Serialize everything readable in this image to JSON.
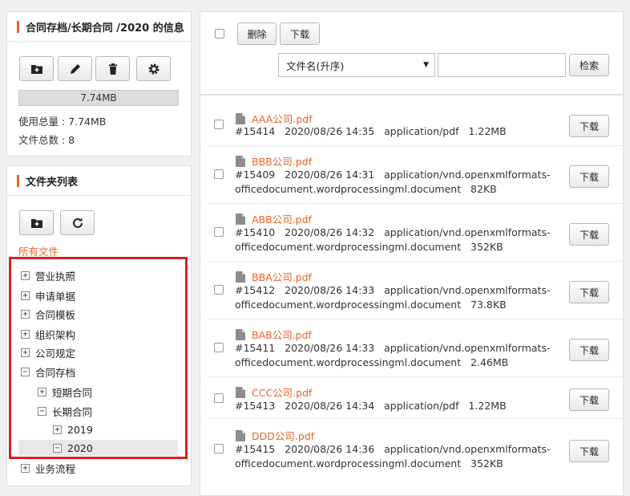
{
  "info_panel": {
    "title": "合同存档/长期合同 /2020 的信息",
    "toolbar_icons": [
      "folder-add-icon",
      "pencil-icon",
      "trash-icon",
      "gear-icon"
    ],
    "usage_bar_text": "7.74MB",
    "total_usage": "使用总量 : 7.74MB",
    "file_count": "文件总数 : 8"
  },
  "folder_panel": {
    "title": "文件夹列表",
    "toolbar_icons": [
      "folder-add-icon",
      "refresh-icon"
    ],
    "all_files_label": "所有文件",
    "tree": [
      {
        "label": "营业执照",
        "toggle": "+",
        "level": 0
      },
      {
        "label": "申请单据",
        "toggle": "+",
        "level": 0
      },
      {
        "label": "合同模板",
        "toggle": "+",
        "level": 0
      },
      {
        "label": "组织架构",
        "toggle": "+",
        "level": 0
      },
      {
        "label": "公司规定",
        "toggle": "+",
        "level": 0
      },
      {
        "label": "合同存档",
        "toggle": "−",
        "level": 0
      },
      {
        "label": "短期合同",
        "toggle": "+",
        "level": 1
      },
      {
        "label": "长期合同",
        "toggle": "−",
        "level": 1
      },
      {
        "label": "2019",
        "toggle": "+",
        "level": 2
      },
      {
        "label": "2020",
        "toggle": "−",
        "level": 2,
        "selected": true
      },
      {
        "label": "业务流程",
        "toggle": "+",
        "level": 0
      }
    ]
  },
  "toolbar": {
    "delete_label": "删除",
    "download_label": "下载",
    "sort_select_value": "文件名(升序)",
    "search_label": "检索",
    "search_value": ""
  },
  "files": [
    {
      "name": "AAA公司.pdf",
      "meta_line1": "#15414   2020/08/26 14:35   application/pdf   1.22MB",
      "meta_line2": "",
      "button": "下载"
    },
    {
      "name": "BBB公司.pdf",
      "meta_line1": "#15409   2020/08/26 14:31   application/vnd.openxmlformats-",
      "meta_line2": "officedocument.wordprocessingml.document   82KB",
      "button": "下载"
    },
    {
      "name": "ABB公司.pdf",
      "meta_line1": "#15410   2020/08/26 14:32   application/vnd.openxmlformats-",
      "meta_line2": "officedocument.wordprocessingml.document   352KB",
      "button": "下载"
    },
    {
      "name": "BBA公司.pdf",
      "meta_line1": "#15412   2020/08/26 14:33   application/vnd.openxmlformats-",
      "meta_line2": "officedocument.wordprocessingml.document   73.8KB",
      "button": "下载"
    },
    {
      "name": "BAB公司.pdf",
      "meta_line1": "#15411   2020/08/26 14:33   application/vnd.openxmlformats-",
      "meta_line2": "officedocument.wordprocessingml.document   2.46MB",
      "button": "下载"
    },
    {
      "name": "CCC公司.pdf",
      "meta_line1": "#15413   2020/08/26 14:34   application/pdf   1.22MB",
      "meta_line2": "",
      "button": "下载"
    },
    {
      "name": "DDD公司.pdf",
      "meta_line1": "#15415   2020/08/26 14:36   application/vnd.openxmlformats-",
      "meta_line2": "officedocument.wordprocessingml.document   352KB",
      "button": "下载"
    }
  ],
  "colors": {
    "accent": "#e8642b",
    "highlight_frame": "#d92027"
  }
}
